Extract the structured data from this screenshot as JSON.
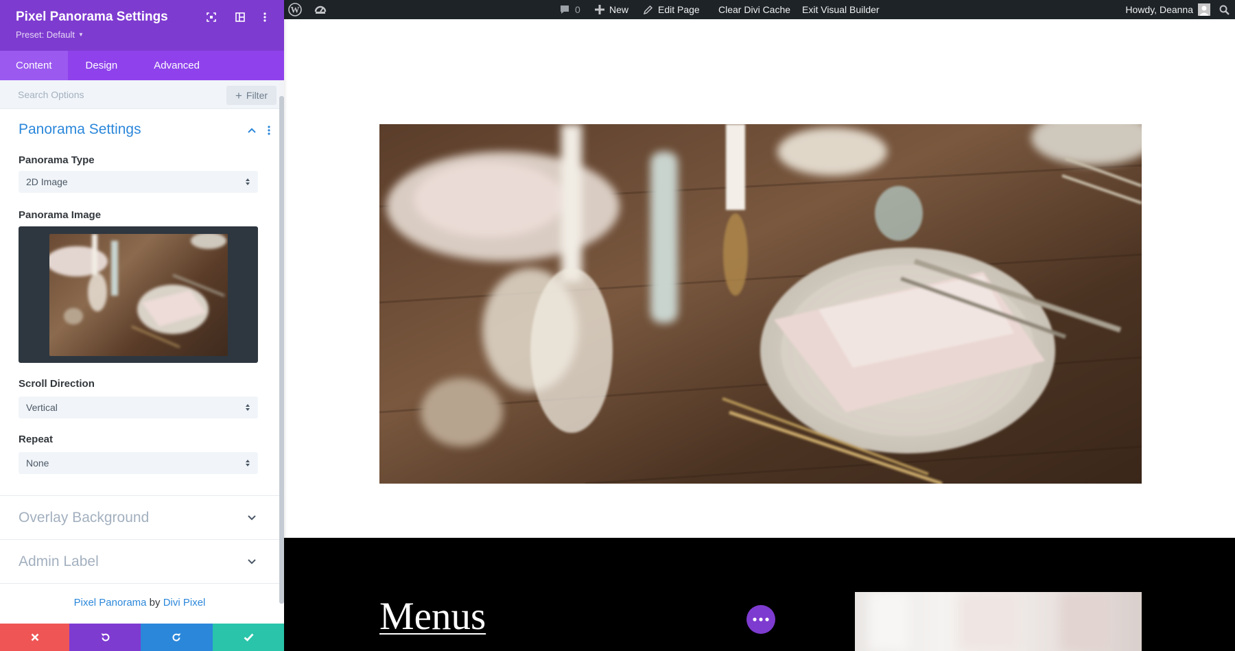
{
  "admin_bar": {
    "comments_count": "0",
    "new_label": "New",
    "edit_label": "Edit Page",
    "clear_cache_label": "Clear Divi Cache",
    "exit_label": "Exit Visual Builder",
    "howdy_label": "Howdy, Deanna"
  },
  "panel": {
    "title": "Pixel Panorama Settings",
    "preset_label": "Preset: Default",
    "tabs": [
      {
        "label": "Content",
        "active": true
      },
      {
        "label": "Design",
        "active": false
      },
      {
        "label": "Advanced",
        "active": false
      }
    ],
    "search": {
      "placeholder": "Search Options",
      "value": ""
    },
    "filter_label": "Filter",
    "section_panorama": {
      "title": "Panorama Settings",
      "expanded": true,
      "fields": {
        "panorama_type": {
          "label": "Panorama Type",
          "value": "2D Image"
        },
        "panorama_image": {
          "label": "Panorama Image"
        },
        "scroll_direction": {
          "label": "Scroll Direction",
          "value": "Vertical"
        },
        "repeat": {
          "label": "Repeat",
          "value": "None"
        }
      }
    },
    "section_overlay": {
      "title": "Overlay Background",
      "expanded": false
    },
    "section_admin": {
      "title": "Admin Label",
      "expanded": false
    },
    "credit": {
      "product": "Pixel Panorama",
      "by": "by",
      "vendor": "Divi Pixel"
    }
  },
  "page": {
    "heading": "Menus"
  },
  "colors": {
    "admin_bar": "#1d2327",
    "panel_header": "#7e3bd0",
    "tabs_bar": "#8f42ec",
    "active_tab": "#9b59f0",
    "link_blue": "#2b87da",
    "cancel_red": "#ef5555",
    "undo_purple": "#7e3bd0",
    "redo_blue": "#2b87da",
    "save_green": "#29c4a9"
  }
}
